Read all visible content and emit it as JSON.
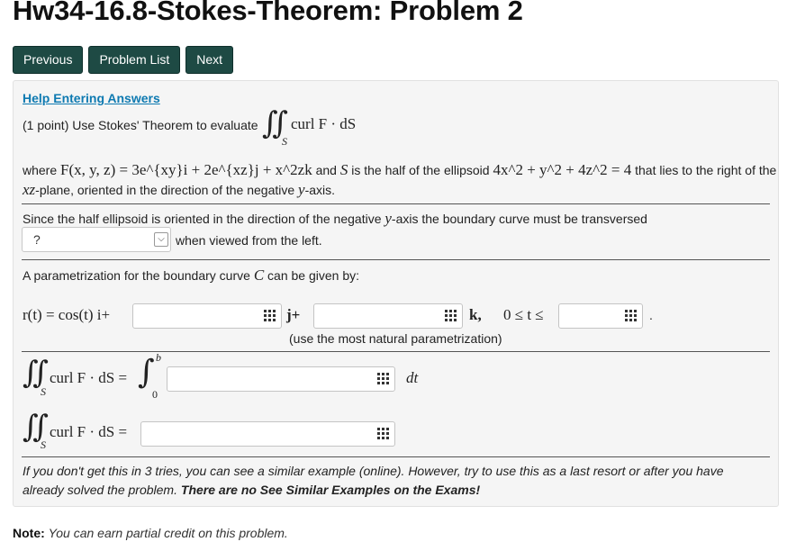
{
  "page": {
    "title": "Hw34-16.8-Stokes-Theorem: Problem 2"
  },
  "nav": {
    "previous": "Previous",
    "problem_list": "Problem List",
    "next": "Next"
  },
  "problem": {
    "help_link": "Help Entering Answers",
    "intro": "(1 point) Use Stokes' Theorem to evaluate",
    "curl_expr": "curl F · dS",
    "where": "where",
    "field_expr": "F(x, y, z) = 3e^{xy}i + 2e^{xz}j + x^2zk",
    "and_text": "and",
    "s_var": "S",
    "surface_text": "is the half of the ellipsoid",
    "ellipsoid_expr": "4x^2 + y^2 + 4z^2 = 4",
    "right_of_text": "that lies to the right of the",
    "plane_expr": "xz",
    "plane_text": "-plane, oriented in the direction of the negative",
    "axis_expr": "y",
    "axis_suffix": "-axis.",
    "section1": {
      "text_before": "Since the half ellipsoid is oriented in the direction of the negative",
      "text_axis": "y",
      "text_after": "-axis the boundary curve must be transversed",
      "select_value": "?",
      "after_select": "when viewed from the left."
    },
    "section2": {
      "text_before": "A parametrization for the boundary curve",
      "curve_var": "C",
      "text_after": "can be given by:",
      "r_lhs": "r(t) = cos(t) i+",
      "j_label": "j+",
      "k_label": "k,",
      "range_label": "0 ≤ t ≤",
      "hint": "(use the most natural parametrization)"
    },
    "section3": {
      "lhs1": "curl F · dS =",
      "upper_b": "b",
      "lower_0": "0",
      "dt": "dt",
      "lhs2": "curl F · dS ="
    },
    "footnote_line1": "If you don't get this in 3 tries, you can see a similar example (online). However, try to use this as a last resort or after you have",
    "footnote_line2_normal": "already solved the problem.",
    "footnote_line2_bold": "There are no See Similar Examples on the Exams!"
  },
  "note": {
    "label": "Note:",
    "text": "You can earn partial credit on this problem."
  },
  "colors": {
    "nav_button_bg": "#1e4a44",
    "link": "#0e7ab1",
    "panel_bg": "#f5f5f5"
  }
}
